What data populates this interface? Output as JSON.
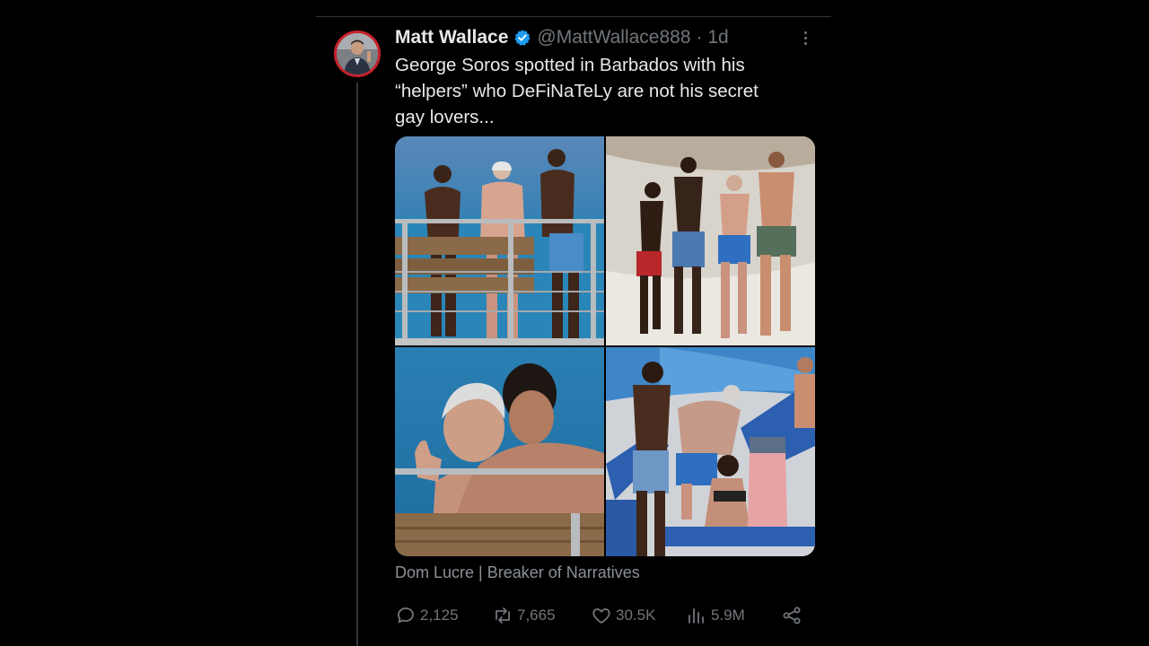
{
  "post": {
    "author": {
      "display_name": "Matt Wallace",
      "handle": "@MattWallace888",
      "time": "· 1d",
      "verified": true,
      "avatar_ring_color": "#c8222c",
      "verified_color": "#1d9bf0"
    },
    "text_lines": [
      "George Soros spotted in Barbados with his",
      "“helpers” who DeFiNaTeLy are not his secret",
      "gay lovers..."
    ],
    "media": [
      {
        "name": "photo-pier-railing"
      },
      {
        "name": "photo-beach-walk"
      },
      {
        "name": "photo-sea-closeup"
      },
      {
        "name": "photo-poolside-umbrellas"
      }
    ],
    "attribution": "Dom Lucre | Breaker of Narratives",
    "stats": {
      "replies": "2,125",
      "reposts": "7,665",
      "likes": "30.5K",
      "views": "5.9M"
    },
    "icons": {
      "reply": "reply-icon",
      "repost": "repost-icon",
      "like": "heart-icon",
      "views": "views-chart-icon",
      "share": "share-icon",
      "more": "more-options-icon",
      "verified": "verified-badge-icon"
    },
    "colors": {
      "background": "#000000",
      "text": "#e7e9ea",
      "muted": "#71767b",
      "divider": "#2f3336"
    }
  }
}
